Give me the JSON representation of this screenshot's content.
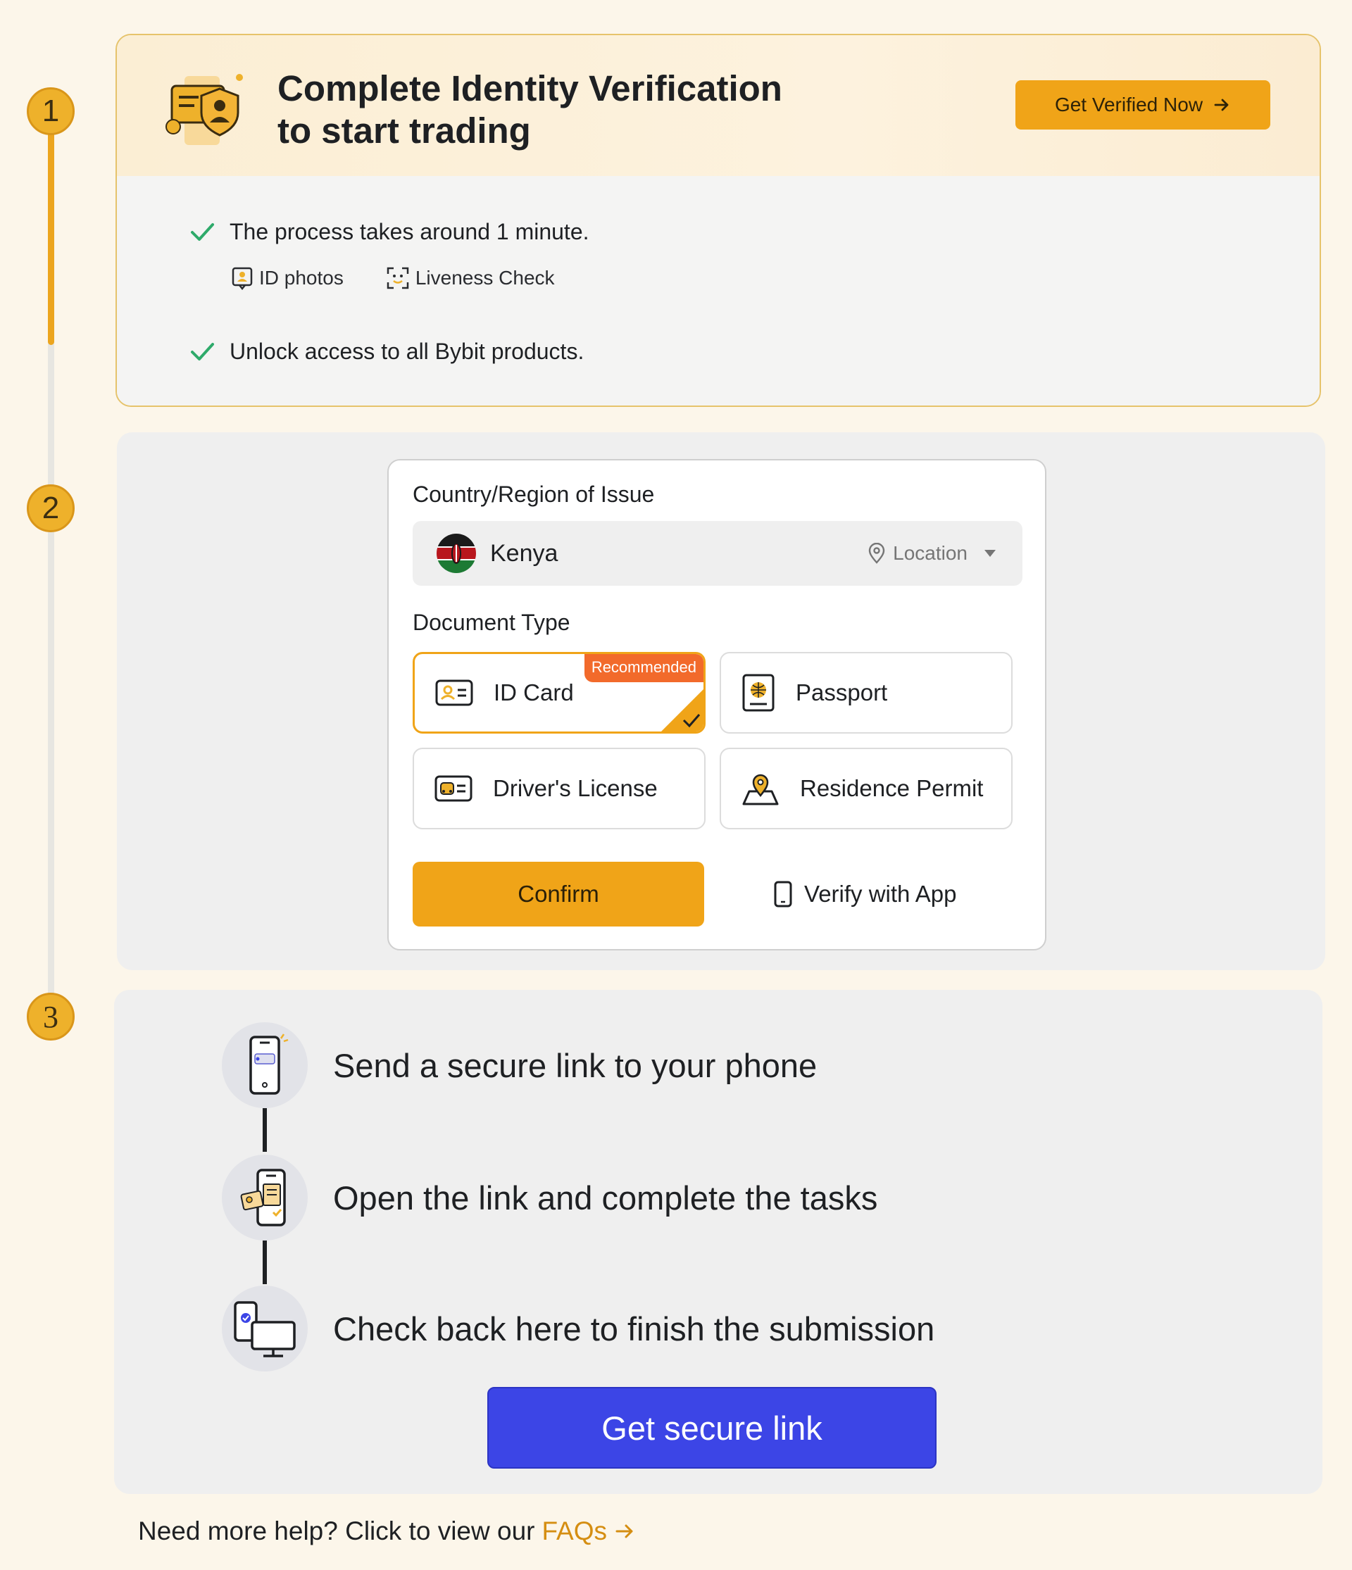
{
  "stepper": {
    "steps": [
      "1",
      "2",
      "3"
    ]
  },
  "verification": {
    "title_line1": "Complete Identity Verification",
    "title_line2": "to start trading",
    "cta_label": "Get Verified Now",
    "benefits": [
      "The process takes around 1 minute.",
      "Unlock access to all Bybit products."
    ],
    "requirements": [
      "ID photos",
      "Liveness Check"
    ]
  },
  "document_form": {
    "country_label": "Country/Region of Issue",
    "country_value": "Kenya",
    "location_label": "Location",
    "doc_type_label": "Document Type",
    "doc_options": [
      {
        "label": "ID Card",
        "icon": "id-card-icon",
        "badge": "Recommended",
        "selected": true
      },
      {
        "label": "Passport",
        "icon": "passport-icon",
        "selected": false
      },
      {
        "label": "Driver's License",
        "icon": "drivers-license-icon",
        "selected": false
      },
      {
        "label": "Residence Permit",
        "icon": "residence-permit-icon",
        "selected": false
      }
    ],
    "confirm_label": "Confirm",
    "verify_app_label": "Verify with App"
  },
  "mobile_flow": {
    "steps": [
      "Send a secure link to your phone",
      "Open the link and complete the tasks",
      "Check back here to finish the submission"
    ],
    "button_label": "Get secure link"
  },
  "help": {
    "text": "Need more help? Click to view our",
    "link_label": "FAQs"
  },
  "colors": {
    "accent": "#f0a418",
    "primary_blue": "#3c45e6",
    "badge_orange": "#f26a2b",
    "success_green": "#2eaa6a"
  }
}
